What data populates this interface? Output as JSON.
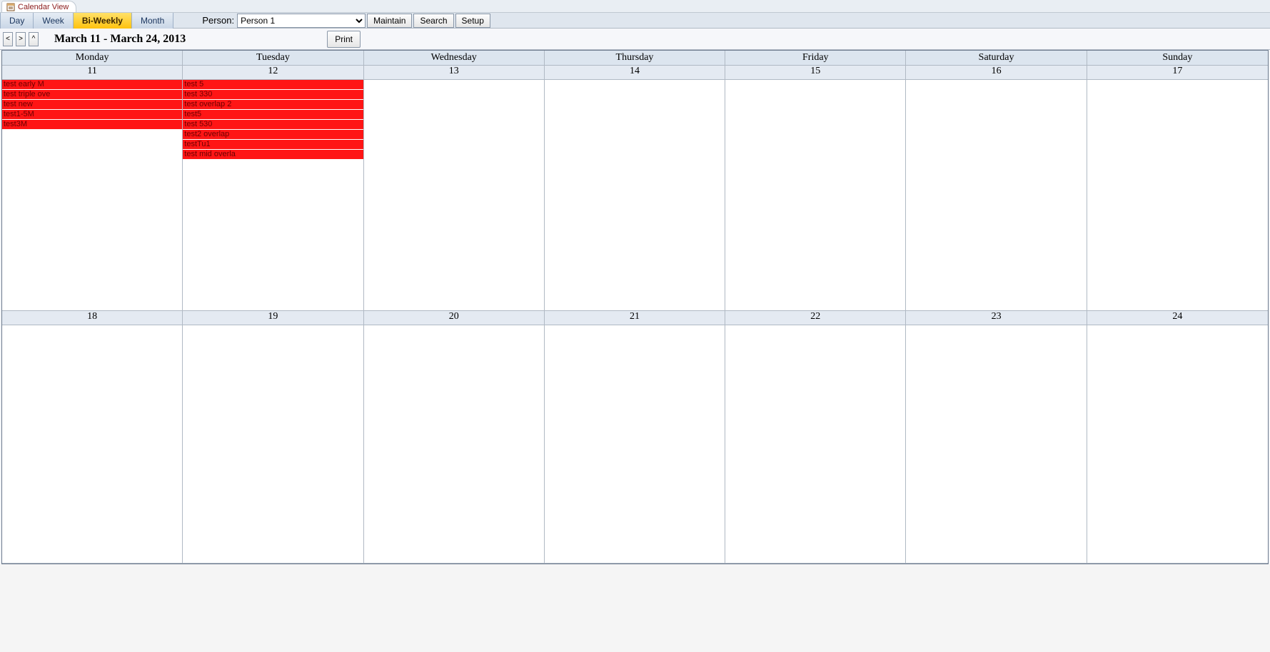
{
  "tab": {
    "title": "Calendar View"
  },
  "viewModes": [
    {
      "label": "Day",
      "active": false
    },
    {
      "label": "Week",
      "active": false
    },
    {
      "label": "Bi-Weekly",
      "active": true
    },
    {
      "label": "Month",
      "active": false
    }
  ],
  "personLabel": "Person:",
  "personSelected": "Person 1",
  "buttons": {
    "maintain": "Maintain",
    "search": "Search",
    "setup": "Setup",
    "print": "Print"
  },
  "nav": {
    "prev": "<",
    "next": ">",
    "up": "^"
  },
  "rangeTitle": "March 11 - March 24, 2013",
  "dayLabels": [
    "Monday",
    "Tuesday",
    "Wednesday",
    "Thursday",
    "Friday",
    "Saturday",
    "Sunday"
  ],
  "weeks": [
    {
      "dates": [
        11,
        12,
        13,
        14,
        15,
        16,
        17
      ],
      "days": [
        {
          "events": [
            "test early M",
            "test triple ove",
            "test new",
            "test1-5M",
            "test3M"
          ]
        },
        {
          "events": [
            "test 5",
            "test 330",
            "test overlap 2",
            "test5",
            "test 530",
            "test2 overlap",
            "testTu1",
            "test mid overla"
          ]
        },
        {
          "events": []
        },
        {
          "events": []
        },
        {
          "events": []
        },
        {
          "events": []
        },
        {
          "events": []
        }
      ]
    },
    {
      "dates": [
        18,
        19,
        20,
        21,
        22,
        23,
        24
      ],
      "days": [
        {
          "events": []
        },
        {
          "events": []
        },
        {
          "events": []
        },
        {
          "events": []
        },
        {
          "events": []
        },
        {
          "events": []
        },
        {
          "events": []
        }
      ]
    }
  ]
}
